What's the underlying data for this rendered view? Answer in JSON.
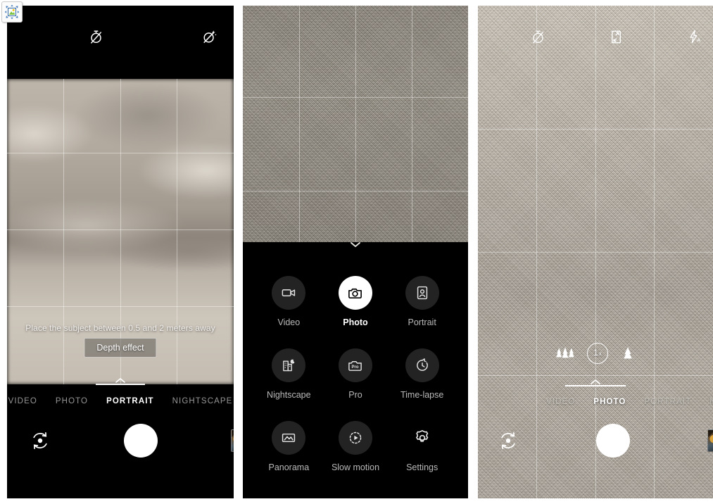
{
  "app_badge": {
    "icon": "image-resize-icon"
  },
  "panels": [
    {
      "name": "portrait-mode-screen",
      "top_icons": [
        {
          "icon": "timer-off-icon",
          "label": "Timer off"
        },
        {
          "icon": "ai-scene-off-icon",
          "label": "AI scene detection off"
        }
      ],
      "hint_text": "Place the subject between 0.5 and 2 meters away",
      "depth_button": "Depth effect",
      "expand_chevron": "chevron-up-icon",
      "modes": [
        {
          "label": "VIDEO",
          "active": false
        },
        {
          "label": "PHOTO",
          "active": false
        },
        {
          "label": "PORTRAIT",
          "active": true
        },
        {
          "label": "NIGHTSCAPE",
          "active": false
        }
      ],
      "controls": {
        "flip_camera": "flip-camera-icon",
        "shutter": "shutter-button",
        "gallery": "gallery-thumbnail"
      }
    },
    {
      "name": "mode-picker-screen",
      "collapse_chevron": "chevron-down-icon",
      "mode_grid": [
        {
          "label": "Video",
          "icon": "video-camera-icon",
          "selected": false,
          "circle": true
        },
        {
          "label": "Photo",
          "icon": "camera-icon",
          "selected": true,
          "circle": true
        },
        {
          "label": "Portrait",
          "icon": "portrait-icon",
          "selected": false,
          "circle": true
        },
        {
          "label": "Nightscape",
          "icon": "nightscape-icon",
          "selected": false,
          "circle": true
        },
        {
          "label": "Pro",
          "icon": "pro-camera-icon",
          "selected": false,
          "circle": true
        },
        {
          "label": "Time-lapse",
          "icon": "time-lapse-icon",
          "selected": false,
          "circle": true
        },
        {
          "label": "Panorama",
          "icon": "panorama-icon",
          "selected": false,
          "circle": true
        },
        {
          "label": "Slow motion",
          "icon": "slow-motion-icon",
          "selected": false,
          "circle": true
        },
        {
          "label": "Settings",
          "icon": "gear-icon",
          "selected": false,
          "circle": false
        }
      ]
    },
    {
      "name": "photo-mode-screen",
      "top_icons": [
        {
          "icon": "timer-off-icon",
          "label": "Timer off"
        },
        {
          "icon": "aspect-ratio-icon",
          "label": "Aspect ratio"
        },
        {
          "icon": "flash-auto-icon",
          "label": "Flash auto"
        }
      ],
      "zoom": {
        "wide_icon": "wide-angle-trees-icon",
        "level": "1",
        "level_suffix": "x",
        "tele_icon": "tele-tree-icon"
      },
      "expand_chevron": "chevron-up-icon",
      "modes": [
        {
          "label": "VIDEO",
          "active": false
        },
        {
          "label": "PHOTO",
          "active": true
        },
        {
          "label": "PORTRAIT",
          "active": false
        },
        {
          "label": "NIGH",
          "active": false
        }
      ],
      "controls": {
        "flip_camera": "flip-camera-icon",
        "shutter": "shutter-button",
        "gallery": "gallery-thumbnail"
      }
    }
  ],
  "colors": {
    "background": "#000000",
    "accent_white": "#ffffff",
    "inactive_label": "#b9b9b9",
    "mode_circle": "#232323"
  }
}
